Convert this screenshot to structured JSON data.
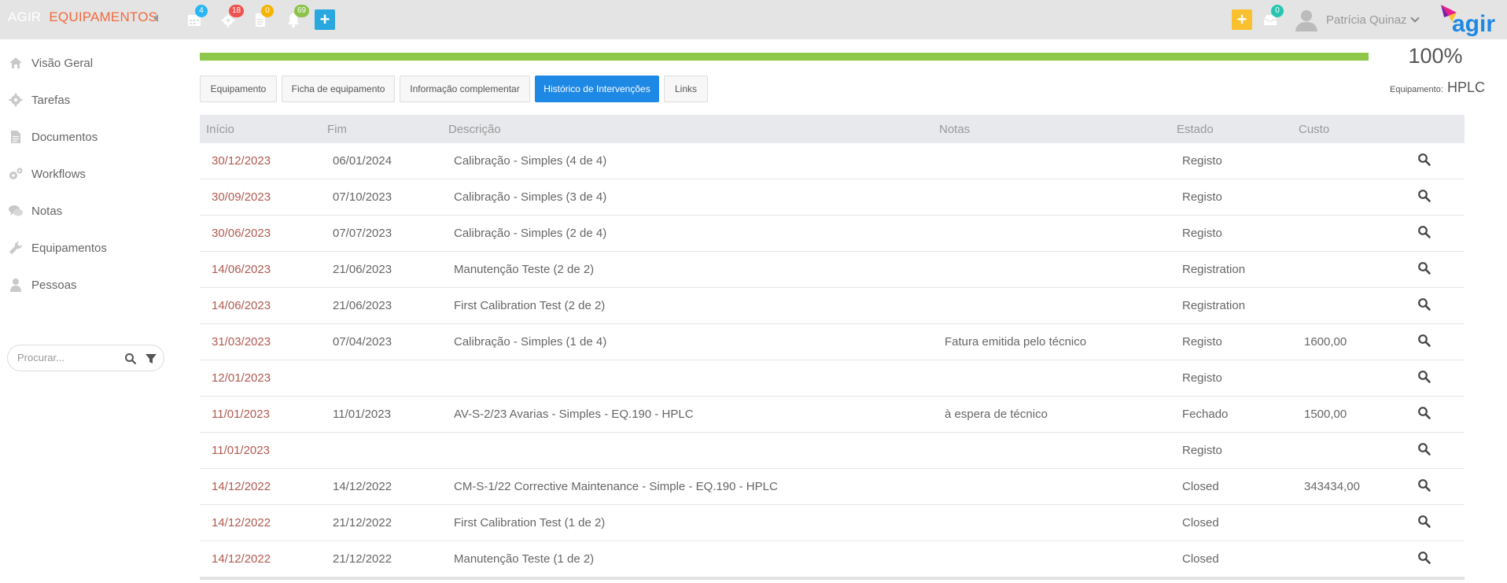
{
  "brand": {
    "part1": "AGIR",
    "part2": "EQUIPAMENTOS"
  },
  "topbar": {
    "icons": [
      {
        "name": "calendar-icon",
        "badge": "4",
        "badge_color": "#29b6f6"
      },
      {
        "name": "gear-icon",
        "badge": "18",
        "badge_color": "#ef5350"
      },
      {
        "name": "document-icon",
        "badge": "0",
        "badge_color": "#f4b400"
      },
      {
        "name": "bell-icon",
        "badge": "69",
        "badge_color": "#8bc34a"
      }
    ],
    "add_left": "+",
    "add_right": "+",
    "inbox_badge": "0",
    "user_name": "Patrícia Quinaz",
    "logo_text": "agir"
  },
  "sidebar": {
    "items": [
      {
        "label": "Visão Geral",
        "icon": "home-icon"
      },
      {
        "label": "Tarefas",
        "icon": "gear-icon"
      },
      {
        "label": "Documentos",
        "icon": "document-icon"
      },
      {
        "label": "Workflows",
        "icon": "gears-icon"
      },
      {
        "label": "Notas",
        "icon": "chat-icon"
      },
      {
        "label": "Equipamentos",
        "icon": "wrench-icon"
      },
      {
        "label": "Pessoas",
        "icon": "person-icon"
      }
    ],
    "search_placeholder": "Procurar..."
  },
  "progress": {
    "value": 1.0,
    "label": "100%"
  },
  "tabs": [
    {
      "label": "Equipamento",
      "active": false
    },
    {
      "label": "Ficha de equipamento",
      "active": false
    },
    {
      "label": "Informação complementar",
      "active": false
    },
    {
      "label": "Histórico de Intervenções",
      "active": true
    },
    {
      "label": "Links",
      "active": false
    }
  ],
  "equipment": {
    "label": "Equipamento:",
    "value": "HPLC"
  },
  "table": {
    "headers": [
      "Início",
      "Fim",
      "Descrição",
      "Notas",
      "Estado",
      "Custo"
    ],
    "rows": [
      {
        "inicio": "30/12/2023",
        "fim": "06/01/2024",
        "descricao": "Calibração - Simples (4 de 4)",
        "notas": "",
        "estado": "Registo",
        "custo": ""
      },
      {
        "inicio": "30/09/2023",
        "fim": "07/10/2023",
        "descricao": "Calibração - Simples (3 de 4)",
        "notas": "",
        "estado": "Registo",
        "custo": ""
      },
      {
        "inicio": "30/06/2023",
        "fim": "07/07/2023",
        "descricao": "Calibração - Simples (2 de 4)",
        "notas": "",
        "estado": "Registo",
        "custo": ""
      },
      {
        "inicio": "14/06/2023",
        "fim": "21/06/2023",
        "descricao": "Manutenção Teste (2 de 2)",
        "notas": "",
        "estado": "Registration",
        "custo": ""
      },
      {
        "inicio": "14/06/2023",
        "fim": "21/06/2023",
        "descricao": "First Calibration Test (2 de 2)",
        "notas": "",
        "estado": "Registration",
        "custo": ""
      },
      {
        "inicio": "31/03/2023",
        "fim": "07/04/2023",
        "descricao": "Calibração - Simples (1 de 4)",
        "notas": "Fatura emitida pelo técnico",
        "estado": "Registo",
        "custo": "1600,00"
      },
      {
        "inicio": "12/01/2023",
        "fim": "",
        "descricao": "",
        "notas": "",
        "estado": "Registo",
        "custo": ""
      },
      {
        "inicio": "11/01/2023",
        "fim": "11/01/2023",
        "descricao": "AV-S-2/23 Avarias - Simples - EQ.190 - HPLC",
        "notas": "à espera de técnico",
        "estado": "Fechado",
        "custo": "1500,00"
      },
      {
        "inicio": "11/01/2023",
        "fim": "",
        "descricao": "",
        "notas": "",
        "estado": "Registo",
        "custo": ""
      },
      {
        "inicio": "14/12/2022",
        "fim": "14/12/2022",
        "descricao": "CM-S-1/22 Corrective Maintenance - Simple - EQ.190 - HPLC",
        "notas": "",
        "estado": "Closed",
        "custo": "343434,00"
      },
      {
        "inicio": "14/12/2022",
        "fim": "21/12/2022",
        "descricao": "First Calibration Test (1 de 2)",
        "notas": "",
        "estado": "Closed",
        "custo": ""
      },
      {
        "inicio": "14/12/2022",
        "fim": "21/12/2022",
        "descricao": "Manutenção Teste (1 de 2)",
        "notas": "",
        "estado": "Closed",
        "custo": ""
      }
    ]
  },
  "colors": {
    "accent": "#1e88e5",
    "brand_orange": "#f26a3d",
    "progress_green": "#8fc74a",
    "add_yellow": "#fbc02d",
    "add_blue": "#29a8e0"
  }
}
